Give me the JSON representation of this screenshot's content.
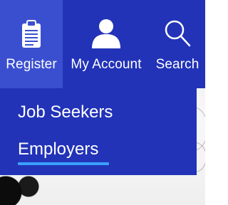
{
  "navbar": {
    "items": [
      {
        "label": "Register",
        "icon": "clipboard-icon",
        "active": true
      },
      {
        "label": "My Account",
        "icon": "user-icon",
        "active": false
      },
      {
        "label": "Search",
        "icon": "search-icon",
        "active": false
      }
    ]
  },
  "dropdown": {
    "items": [
      {
        "label": "Job Seekers",
        "selected": false
      },
      {
        "label": "Employers",
        "selected": true
      }
    ]
  },
  "colors": {
    "nav_background": "#2233b8",
    "active_tab": "#3a4fcf",
    "text": "#ffffff",
    "underline": "#3aa0ff"
  }
}
